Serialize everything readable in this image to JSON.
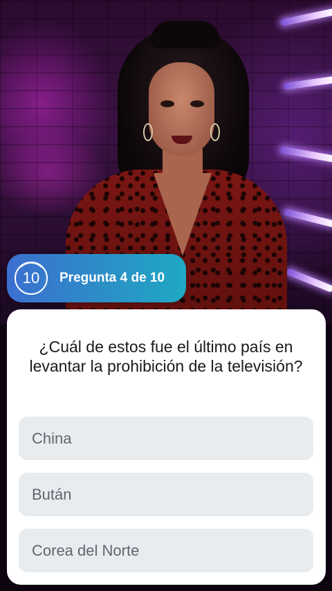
{
  "badge": {
    "timer_value": "10",
    "label": "Pregunta 4 de 10"
  },
  "question": {
    "text": "¿Cuál de estos fue el último país en levantar la prohibición de la televisión?"
  },
  "options": [
    {
      "label": "China"
    },
    {
      "label": "Bután"
    },
    {
      "label": "Corea del Norte"
    }
  ],
  "colors": {
    "badge_gradient_start": "#3b6fd0",
    "badge_gradient_end": "#1fa9c4",
    "card_background": "#ffffff",
    "option_background": "#e9ecef",
    "option_text": "#5f6670",
    "question_text": "#1a1a1a"
  }
}
